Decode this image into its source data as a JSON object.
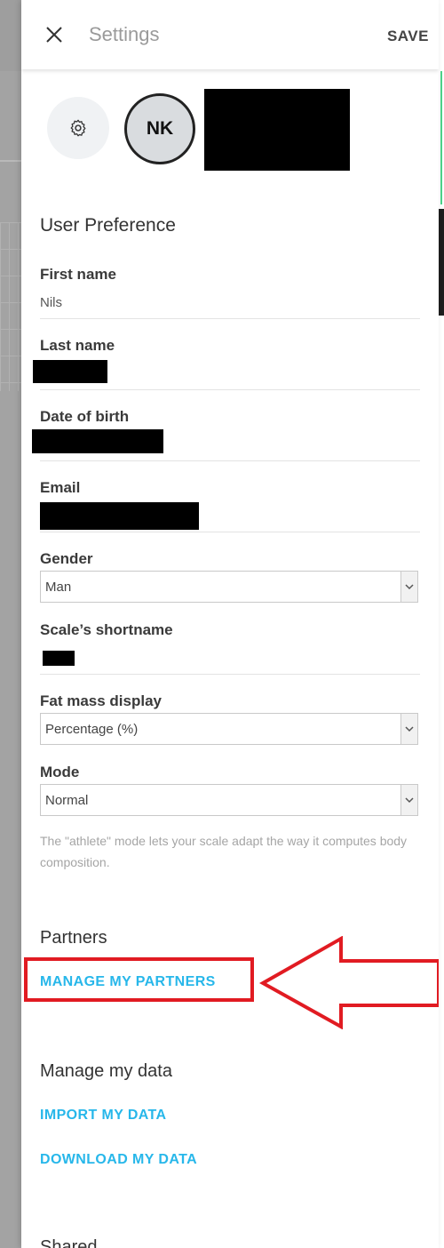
{
  "header": {
    "title": "Settings",
    "save_label": "SAVE"
  },
  "profile": {
    "initials": "NK"
  },
  "user_preference": {
    "section_title": "User Preference",
    "first_name_label": "First name",
    "first_name_value": "Nils",
    "last_name_label": "Last name",
    "dob_label": "Date of birth",
    "email_label": "Email",
    "gender_label": "Gender",
    "gender_value": "Man",
    "shortname_label": "Scale’s shortname",
    "fat_mass_label": "Fat mass display",
    "fat_mass_value": "Percentage (%)",
    "mode_label": "Mode",
    "mode_value": "Normal",
    "mode_hint": "The \"athlete\" mode lets your scale adapt the way it computes body composition."
  },
  "partners": {
    "section_title": "Partners",
    "manage_label": "MANAGE MY PARTNERS"
  },
  "manage_data": {
    "section_title": "Manage my data",
    "import_label": "IMPORT MY DATA",
    "download_label": "DOWNLOAD MY DATA"
  },
  "shared": {
    "section_title": "Shared"
  },
  "colors": {
    "accent": "#27b7ea",
    "annotation": "#e11b22"
  }
}
